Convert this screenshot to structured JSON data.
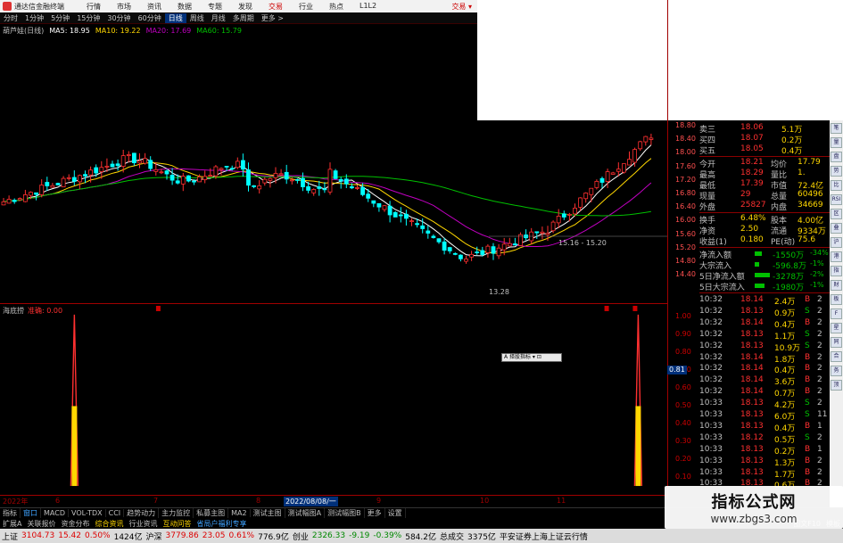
{
  "titlebar": {
    "app_name": "通达信金融终端",
    "menu": [
      "行情",
      "市场",
      "资讯",
      "数据",
      "专题",
      "发现",
      "交易",
      "行业",
      "热点",
      "L1L2"
    ],
    "active_menu_index": 6,
    "right_text": "交易 ▾"
  },
  "periods": [
    "分时",
    "1分钟",
    "5分钟",
    "15分钟",
    "30分钟",
    "60分钟",
    "日线",
    "周线",
    "月线",
    "多周期",
    "更多 >"
  ],
  "active_period_index": 6,
  "ma_legend": {
    "name": "葫芦娃(日线)",
    "items": [
      {
        "label": "MA5: 18.95",
        "color": "#ffffff"
      },
      {
        "label": "MA10: 19.22",
        "color": "#ffd700"
      },
      {
        "label": "MA20: 17.69",
        "color": "#c000c0"
      },
      {
        "label": "MA60: 15.79",
        "color": "#00c000"
      }
    ]
  },
  "price_axis": [
    "18.80",
    "18.40",
    "18.00",
    "17.60",
    "17.20",
    "16.80",
    "16.40",
    "16.00",
    "15.60",
    "15.20",
    "14.80",
    "14.40"
  ],
  "indicator_axis": [
    "1.00",
    "0.90",
    "0.80",
    "0.70",
    "0.60",
    "0.50",
    "0.40",
    "0.30",
    "0.20",
    "0.10"
  ],
  "indicator": {
    "name": "海底捞",
    "value_label": "准确: 0.00",
    "tag_value": "0.81"
  },
  "annotations": {
    "low_label": "13.28",
    "range_label": "15.16 - 15.20"
  },
  "popup_text": "A 择股指标 ▾ ⊡",
  "quote": {
    "asks": [
      {
        "label": "卖三",
        "price": "18.06",
        "vol": "5.1万"
      },
      {
        "label": "买四",
        "price": "18.07",
        "vol": "0.2万"
      },
      {
        "label": "买五",
        "price": "18.05",
        "vol": "0.4万"
      }
    ],
    "stats": [
      {
        "l1": "今开",
        "v1": "18.21",
        "l2": "均价",
        "v2": "17.79"
      },
      {
        "l1": "最高",
        "v1": "18.29",
        "l2": "量比",
        "v2": "1."
      },
      {
        "l1": "最低",
        "v1": "17.39",
        "l2": "市值",
        "v2": "72.4亿"
      },
      {
        "l1": "现量",
        "v1": "29",
        "l2": "总量",
        "v2": "60496"
      },
      {
        "l1": "外盘",
        "v1": "25827",
        "l2": "内盘",
        "v2": "34669"
      }
    ],
    "stats2": [
      {
        "l1": "换手",
        "v1": "6.48%",
        "l2": "股本",
        "v2": "4.00亿"
      },
      {
        "l1": "净资",
        "v1": "2.50",
        "l2": "流通",
        "v2": "9334万"
      },
      {
        "l1": "收益(1)",
        "v1": "0.180",
        "l2": "PE(动)",
        "v2": "75.6"
      }
    ],
    "flows": [
      {
        "label": "净流入额",
        "value": "-1550万",
        "pct": "-34%",
        "bar": 0.25
      },
      {
        "label": "大宗流入",
        "value": "-596.8万",
        "pct": "-1%",
        "bar": 0.15
      },
      {
        "label": "5日净流入额",
        "value": "-3278万",
        "pct": "-2%",
        "bar": 0.55
      },
      {
        "label": "5日大宗流入",
        "value": "-1980万",
        "pct": "-1%",
        "bar": 0.35
      }
    ],
    "ticks": [
      {
        "t": "10:32",
        "p": "18.14",
        "v": "2.4万",
        "s": "B",
        "n": "2"
      },
      {
        "t": "10:32",
        "p": "18.13",
        "v": "0.9万",
        "s": "S",
        "n": "2"
      },
      {
        "t": "10:32",
        "p": "18.14",
        "v": "0.4万",
        "s": "B",
        "n": "2"
      },
      {
        "t": "10:32",
        "p": "18.13",
        "v": "1.1万",
        "s": "S",
        "n": "2"
      },
      {
        "t": "10:32",
        "p": "18.13",
        "v": "10.9万",
        "s": "S",
        "n": "2"
      },
      {
        "t": "10:32",
        "p": "18.14",
        "v": "1.8万",
        "s": "B",
        "n": "2"
      },
      {
        "t": "10:32",
        "p": "18.14",
        "v": "0.4万",
        "s": "B",
        "n": "2"
      },
      {
        "t": "10:32",
        "p": "18.14",
        "v": "3.6万",
        "s": "B",
        "n": "2"
      },
      {
        "t": "10:32",
        "p": "18.14",
        "v": "0.7万",
        "s": "B",
        "n": "2"
      },
      {
        "t": "10:33",
        "p": "18.13",
        "v": "4.2万",
        "s": "S",
        "n": "2"
      },
      {
        "t": "10:33",
        "p": "18.13",
        "v": "6.0万",
        "s": "S",
        "n": "11"
      },
      {
        "t": "10:33",
        "p": "18.13",
        "v": "0.4万",
        "s": "B",
        "n": "1"
      },
      {
        "t": "10:33",
        "p": "18.12",
        "v": "0.5万",
        "s": "S",
        "n": "2"
      },
      {
        "t": "10:33",
        "p": "18.13",
        "v": "0.2万",
        "s": "B",
        "n": "1"
      },
      {
        "t": "10:33",
        "p": "18.13",
        "v": "1.3万",
        "s": "B",
        "n": "2"
      },
      {
        "t": "10:33",
        "p": "18.13",
        "v": "1.7万",
        "s": "B",
        "n": "2"
      },
      {
        "t": "10:33",
        "p": "18.13",
        "v": "0.6万",
        "s": "B",
        "n": "2"
      }
    ]
  },
  "dates": [
    {
      "label": "2022年",
      "sel": false
    },
    {
      "label": "6",
      "sel": false
    },
    {
      "label": "7",
      "sel": false
    },
    {
      "label": "8",
      "sel": false
    },
    {
      "label": "2022/08/08/一",
      "sel": true
    },
    {
      "label": "9",
      "sel": false
    },
    {
      "label": "10",
      "sel": false
    },
    {
      "label": "11",
      "sel": false
    }
  ],
  "tabs": [
    "指标",
    "窗口",
    "MACD",
    "VOL-TDX",
    "CCI",
    "趋势动力",
    "主力监控",
    "私募主图",
    "MA2",
    "测试主图",
    "测试幅图A",
    "测试幅图B",
    "更多",
    "设置"
  ],
  "tabs2": [
    "扩展A",
    "关联报价",
    "资金分布",
    "综合资讯",
    "行业资讯",
    "互动问答",
    "省局户福利专享",
    "图文F10",
    "模板"
  ],
  "side_tabs": [
    "笔",
    "量",
    "盘",
    "势",
    "比",
    "RSI",
    "区",
    "叠",
    "沪",
    "港",
    "指",
    "财",
    "板",
    "F",
    "星",
    "同",
    "合",
    "务",
    "顶"
  ],
  "statusbar": [
    {
      "text": "上证",
      "cls": ""
    },
    {
      "text": "3104.73",
      "cls": "up"
    },
    {
      "text": "15.42",
      "cls": "up"
    },
    {
      "text": "0.50%",
      "cls": "up"
    },
    {
      "text": "1424亿",
      "cls": ""
    },
    {
      "text": "沪深",
      "cls": ""
    },
    {
      "text": "3779.86",
      "cls": "up"
    },
    {
      "text": "23.05",
      "cls": "up"
    },
    {
      "text": "0.61%",
      "cls": "up"
    },
    {
      "text": "776.9亿",
      "cls": ""
    },
    {
      "text": "创业",
      "cls": ""
    },
    {
      "text": "2326.33",
      "cls": "dn"
    },
    {
      "text": "-9.19",
      "cls": "dn"
    },
    {
      "text": "-0.39%",
      "cls": "dn"
    },
    {
      "text": "584.2亿",
      "cls": ""
    },
    {
      "text": "总成交",
      "cls": ""
    },
    {
      "text": "3375亿",
      "cls": ""
    },
    {
      "text": "平安证券上海上证云行情",
      "cls": ""
    }
  ],
  "watermark": {
    "line1": "指标公式网",
    "line2": "www.zbgs3.com"
  },
  "colors": {
    "up": "#ff3030",
    "down": "#00ffff",
    "ma5": "#ffffff",
    "ma10": "#ffd700",
    "ma20": "#c000c0",
    "ma60": "#00c000",
    "indicator": "#ffd700"
  }
}
